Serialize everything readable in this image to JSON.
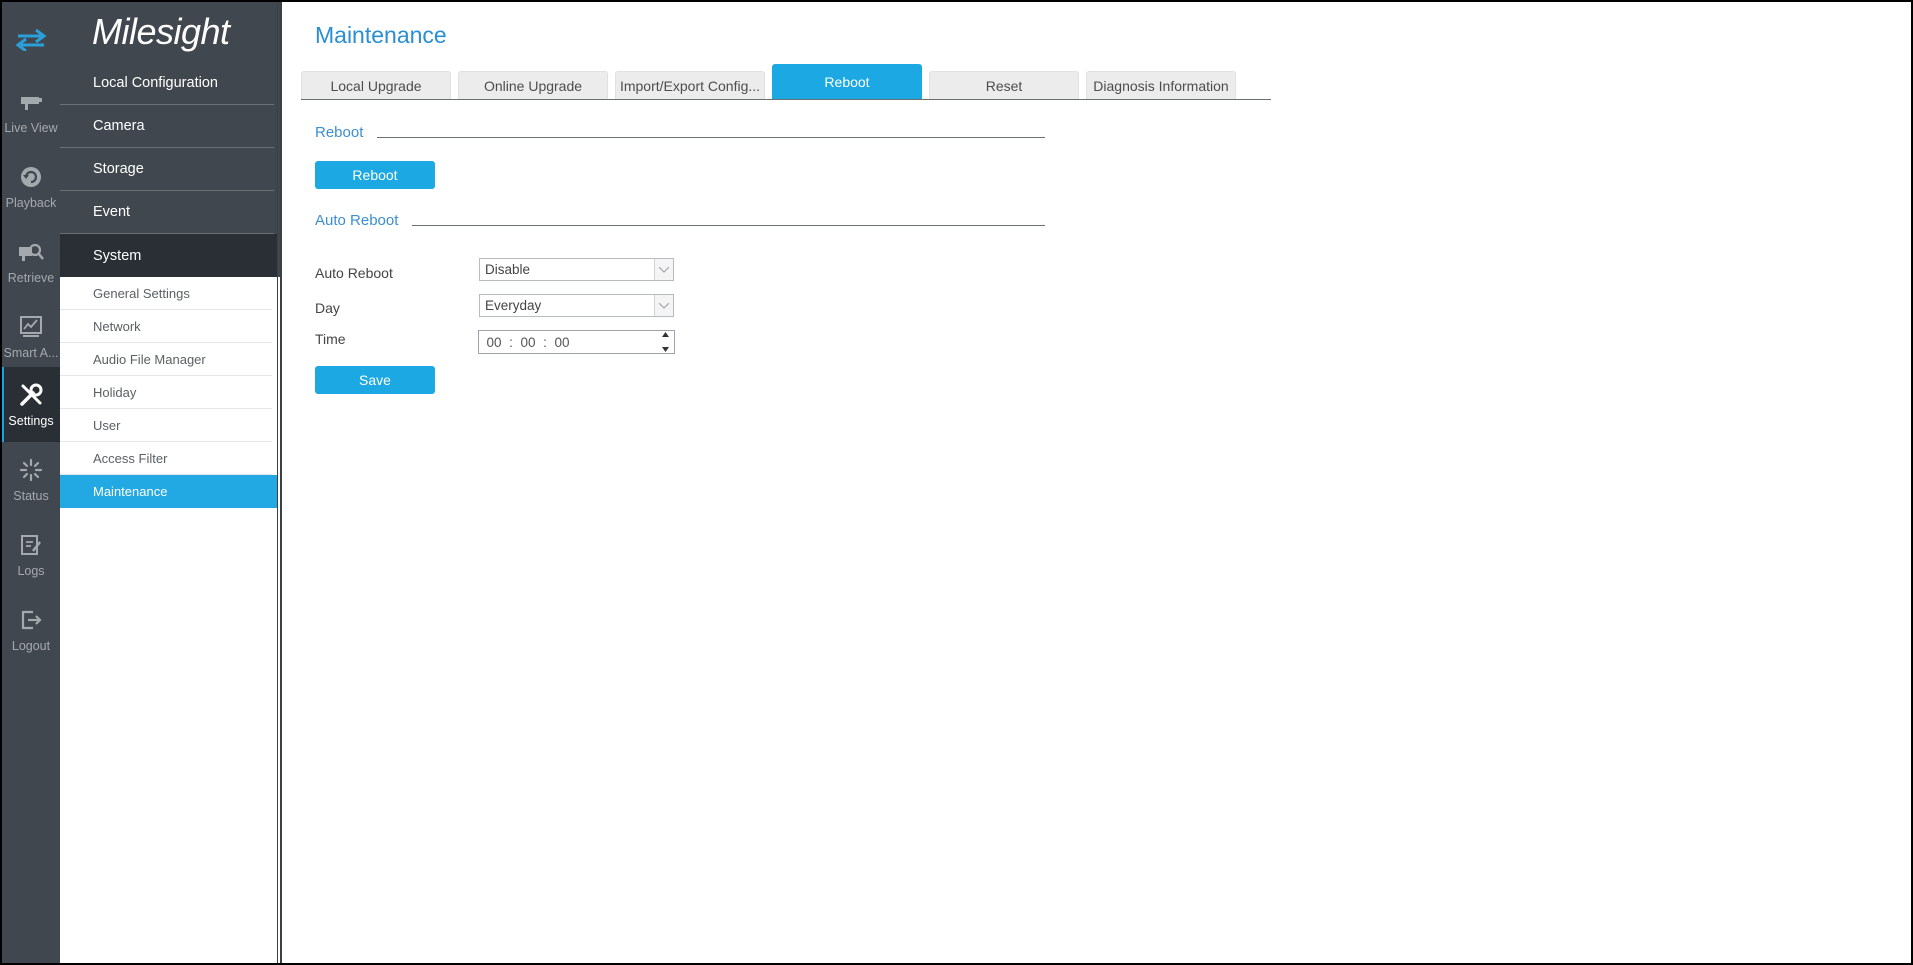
{
  "rail": {
    "items": [
      {
        "name": "live-view",
        "label": "Live View",
        "icon": "live-view-icon"
      },
      {
        "name": "playback",
        "label": "Playback",
        "icon": "playback-icon"
      },
      {
        "name": "retrieve",
        "label": "Retrieve",
        "icon": "retrieve-icon"
      },
      {
        "name": "smart-analysis",
        "label": "Smart A...",
        "icon": "smart-analysis-icon"
      },
      {
        "name": "settings",
        "label": "Settings",
        "icon": "settings-icon",
        "active": true
      },
      {
        "name": "status",
        "label": "Status",
        "icon": "status-icon"
      },
      {
        "name": "logs",
        "label": "Logs",
        "icon": "logs-icon"
      },
      {
        "name": "logout",
        "label": "Logout",
        "icon": "logout-icon"
      }
    ]
  },
  "logo": "Milesight",
  "menu": {
    "items": [
      "Local Configuration",
      "Camera",
      "Storage",
      "Event",
      "System"
    ],
    "active": "System",
    "sub_items": [
      "General Settings",
      "Network",
      "Audio File Manager",
      "Holiday",
      "User",
      "Access Filter",
      "Maintenance"
    ],
    "active_sub": "Maintenance"
  },
  "page": {
    "title": "Maintenance",
    "tabs": [
      "Local Upgrade",
      "Online Upgrade",
      "Import/Export Config...",
      "Reboot",
      "Reset",
      "Diagnosis Information"
    ],
    "active_tab": "Reboot"
  },
  "reboot": {
    "section_title": "Reboot",
    "button_label": "Reboot"
  },
  "auto_reboot": {
    "section_title": "Auto Reboot",
    "auto_reboot_label": "Auto Reboot",
    "auto_reboot_value": "Disable",
    "day_label": "Day",
    "day_value": "Everyday",
    "time_label": "Time",
    "time_hh": "00",
    "time_mm": "00",
    "time_ss": "00",
    "time_sep": ":",
    "save_label": "Save"
  },
  "colors": {
    "accent": "#1ca8e3",
    "rail_bg": "#41474e",
    "rail_active": "#2a2f35",
    "title": "#2a8fd2"
  }
}
